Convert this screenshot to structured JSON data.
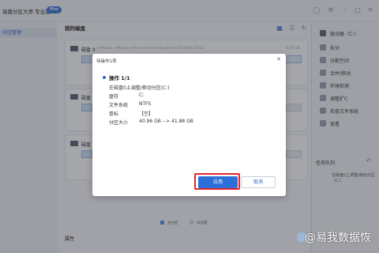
{
  "app": {
    "title": "易我分区大师  专业版",
    "badge": "Pro"
  },
  "sidebar": {
    "items": [
      {
        "label": "分区管理"
      },
      {
        "label": ""
      },
      {
        "label": ""
      },
      {
        "label": ""
      },
      {
        "label": ""
      },
      {
        "label": ""
      },
      {
        "label": ""
      }
    ]
  },
  "main": {
    "section_title": "我的磁盘",
    "disks": [
      {
        "name": "磁盘 0",
        "detail": "(VMware, VMware Virtual S Serial Attached SCSI (SAS) Disk)",
        "info": "8.00 GB"
      },
      {
        "name": "磁盘",
        "detail": "",
        "info": ""
      },
      {
        "name": "磁盘",
        "detail": "",
        "info": ""
      }
    ],
    "legend": [
      {
        "label": "主分区",
        "color": "#5b8fe0"
      },
      {
        "label": "未分配",
        "color": "#cfd4dc"
      }
    ],
    "bottom_label": "属性"
  },
  "right_panel": {
    "drive": "驱动器（C:）",
    "actions": [
      "拆分",
      "分配空间",
      "合并/移动",
      "环境检测",
      "调整扩C",
      "检查文件系统",
      "查看"
    ],
    "queue_label": "任务队列",
    "queue_item": "在磁盘0上调整/移动分区（C:）"
  },
  "dialog": {
    "title": "待操作1项",
    "close": "✕",
    "op_head": "操作 1/1",
    "op_desc": "在磁盘0上调整/移动分区(C:)",
    "fields": [
      {
        "label": "盘符",
        "value": "C:"
      },
      {
        "label": "文件系统",
        "value": "NTFS"
      },
      {
        "label": "卷标",
        "value": "【空】"
      },
      {
        "label": "分区大小",
        "value": "40.96 GB --> 41.88 GB"
      }
    ],
    "apply": "应用",
    "cancel": "取消"
  },
  "watermark": "@易我数据恢",
  "colors": {
    "accent": "#2d6fd8",
    "highlight": "#e0262b"
  }
}
